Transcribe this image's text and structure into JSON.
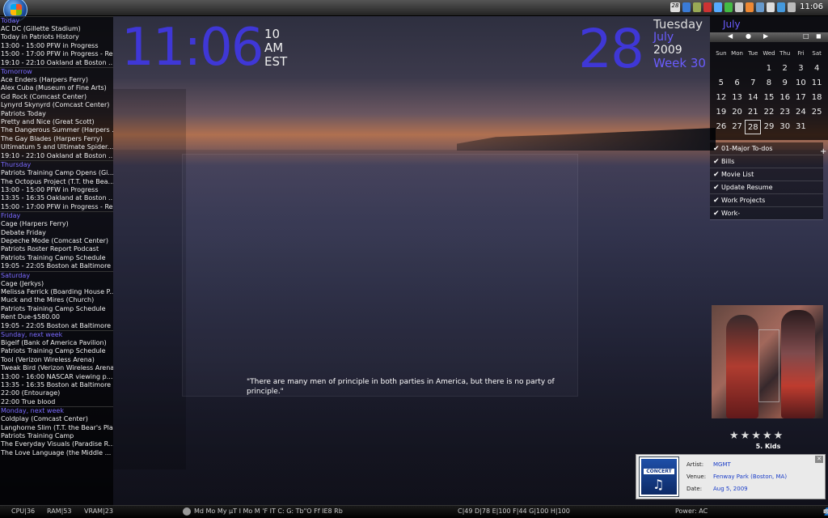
{
  "tray": {
    "clock": "11:06",
    "badge": "28"
  },
  "agenda": [
    {
      "day": "Today",
      "events": [
        "AC DC (Gillette Stadium)",
        "Today in Patriots History",
        "13:00 - 15:00 PFW in Progress",
        "15:00 - 17:00 PFW in Progress - Re...",
        "19:10 - 22:10 Oakland at Boston ..."
      ]
    },
    {
      "day": "Tomorrow",
      "events": [
        "Ace Enders (Harpers Ferry)",
        "Alex Cuba (Museum of Fine Arts)",
        "Gd Rock (Comcast Center)",
        "Lynyrd Skynyrd (Comcast Center)",
        "Patriots Today",
        "Pretty and Nice (Great Scott)",
        "The Dangerous Summer (Harpers ...",
        "The Gay Blades (Harpers Ferry)",
        "Ultimatum 5 and Ultimate Spider...",
        "19:10 - 22:10 Oakland at Boston ..."
      ]
    },
    {
      "day": "Thursday",
      "events": [
        "Patriots Training Camp Opens (Gi...",
        "The Octopus Project (T.T. the Bea...",
        "13:00 - 15:00 PFW in Progress",
        "13:35 - 16:35 Oakland at Boston ...",
        "15:00 - 17:00 PFW in Progress - Re..."
      ]
    },
    {
      "day": "Friday",
      "events": [
        "Cage (Harpers Ferry)",
        "Debate Friday",
        "Depeche Mode (Comcast Center)",
        "Patriots Roster Report Podcast",
        "Patriots Training Camp Schedule",
        "19:05 - 22:05 Boston at Baltimore ..."
      ]
    },
    {
      "day": "Saturday",
      "events": [
        "Cage (Jerkys)",
        "Melissa Ferrick (Boarding House P...",
        "Muck and the Mires (Church)",
        "Patriots Training Camp Schedule",
        "Rent Due-$580.00",
        "19:05 - 22:05 Boston at Baltimore ..."
      ]
    },
    {
      "day": "Sunday, next week",
      "events": [
        "Bigelf (Bank of America Pavilion)",
        "Patriots Training Camp Schedule",
        "Tool (Verizon Wireless Arena)",
        "Tweak Bird (Verizon Wireless Arena)",
        "13:00 - 16:00 NASCAR viewing p...",
        "13:35 - 16:35 Boston at Baltimore ...",
        "22:00 (Entourage)",
        "22:00 True blood"
      ]
    },
    {
      "day": "Monday, next week",
      "events": [
        "Coldplay (Comcast Center)",
        "Langhorne Slim (T.T. the Bear's Pla...",
        "Patriots Training Camp",
        "The Everyday Visuals (Paradise R...",
        "The Love Language (the Middle ..."
      ]
    }
  ],
  "clock": {
    "time": "11:06",
    "seconds": "10",
    "ampm": "AM",
    "tz": "EST"
  },
  "date": {
    "day_num": "28",
    "weekday": "Tuesday",
    "month": "July",
    "year": "2009",
    "week": "Week 30"
  },
  "calendar": {
    "month": "July",
    "headers": [
      "Sun",
      "Mon",
      "Tue",
      "Wed",
      "Thu",
      "Fri",
      "Sat"
    ],
    "rows": [
      [
        "",
        "",
        "",
        "1",
        "2",
        "3",
        "4"
      ],
      [
        "5",
        "6",
        "7",
        "8",
        "9",
        "10",
        "11"
      ],
      [
        "12",
        "13",
        "14",
        "15",
        "16",
        "17",
        "18"
      ],
      [
        "19",
        "20",
        "21",
        "22",
        "23",
        "24",
        "25"
      ],
      [
        "26",
        "27",
        "28",
        "29",
        "30",
        "31",
        ""
      ]
    ],
    "today": "28"
  },
  "todo": [
    "01-Major To-dos",
    "Bills",
    "Movie List",
    "Update Resume",
    "Work Projects",
    "Work-"
  ],
  "quote": "\"There are many men of principle in both parties in America, but there is no party of principle.\"",
  "now_playing": {
    "stars": "★★★★★",
    "track": "5. Kids"
  },
  "concert": {
    "badge": "CONCERT",
    "rows": [
      {
        "k": "Artist:",
        "v": "MGMT"
      },
      {
        "k": "Venue:",
        "v": "Fenway Park (Boston, MA)"
      },
      {
        "k": "Date:",
        "v": "Aug 5, 2009"
      }
    ]
  },
  "bottom": {
    "cpu": "CPU|36",
    "ram": "RAM|53",
    "vram": "VRAM|23",
    "apps": "Md Mo My µT  I  Mo M 'F  IT  C: G: Tb\"O  Ff IE8 Rb",
    "drives": "C|49   D|78   E|100   F|44   G|100   H|100",
    "power": "Power: AC"
  }
}
